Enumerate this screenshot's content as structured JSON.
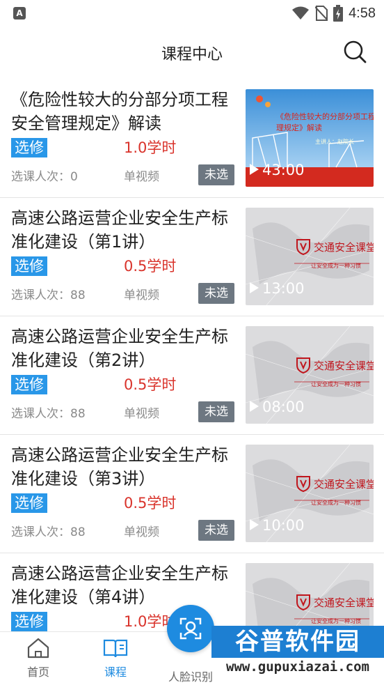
{
  "status_bar": {
    "time": "4:58",
    "app_icon": "A"
  },
  "header": {
    "title": "课程中心"
  },
  "courses": [
    {
      "title": "《危险性较大的分部分项工程安全管理规定》解读",
      "tag": "选修",
      "hours": "1.0学时",
      "enroll": "选课人次：0",
      "video_type": "单视频",
      "status": "未选",
      "duration": "43:00",
      "thumb_title": "《危险性较大的分部分项工程管理规定》解读",
      "thumb_presenter": "主讲人：赵院长"
    },
    {
      "title": "高速公路运营企业安全生产标准化建设（第1讲）",
      "tag": "选修",
      "hours": "0.5学时",
      "enroll": "选课人次：88",
      "video_type": "单视频",
      "status": "未选",
      "duration": "13:00"
    },
    {
      "title": "高速公路运营企业安全生产标准化建设（第2讲）",
      "tag": "选修",
      "hours": "0.5学时",
      "enroll": "选课人次：88",
      "video_type": "单视频",
      "status": "未选",
      "duration": "08:00"
    },
    {
      "title": "高速公路运营企业安全生产标准化建设（第3讲）",
      "tag": "选修",
      "hours": "0.5学时",
      "enroll": "选课人次：88",
      "video_type": "单视频",
      "status": "未选",
      "duration": "10:00"
    },
    {
      "title": "高速公路运营企业安全生产标准化建设（第4讲）",
      "tag": "选修",
      "hours": "1.0学时"
    }
  ],
  "brand": {
    "name": "交通安全课堂",
    "slogan": "让安全成为一种习惯"
  },
  "bottom_nav": {
    "home": "首页",
    "course": "课程",
    "face": "人脸识别"
  },
  "watermark": {
    "title": "谷普软件园",
    "url": "www.gupuxiazai.com"
  },
  "colors": {
    "accent": "#1e8be0",
    "elective_bg": "#2997e8",
    "hours": "#d9332b",
    "status_tag": "#6d7781"
  }
}
